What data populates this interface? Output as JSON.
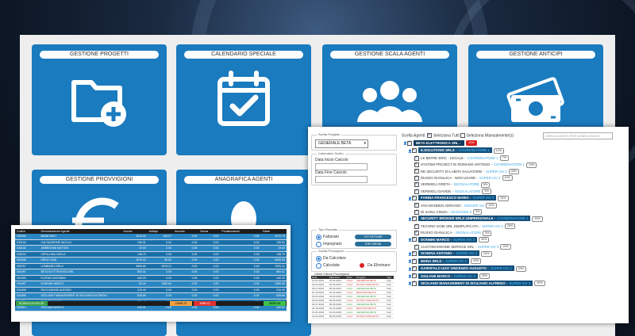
{
  "tiles": [
    {
      "label": "GESTIONE PROGETTI",
      "icon": "folder-plus-icon"
    },
    {
      "label": "CALENDARIO SPECIALE",
      "icon": "calendar-check-icon"
    },
    {
      "label": "GESTIONE SCALA AGENTI",
      "icon": "users-group-icon"
    },
    {
      "label": "GESTIONE ANTICIPI",
      "icon": "money-bills-icon"
    },
    {
      "label": "GESTIONE PROVVIGIONI",
      "icon": "euro-icon"
    },
    {
      "label": "ANAGRAFICA AGENTI",
      "icon": "person-icon"
    }
  ],
  "commission_table": {
    "headers": [
      "Codice",
      "Denominazione Agente",
      "Dovuto",
      "Anticipi",
      "Acconto",
      "Bonus",
      "Penalizzazioni",
      "Totale"
    ],
    "rows": [
      [
        "035090",
        "MINNI BRCI",
        "4310.00",
        "105.07",
        "0.00",
        "0.00",
        "0.00",
        "4072.75"
      ],
      [
        "033134",
        "CALTAGIRONE NICOLA",
        "130.01",
        "0.00",
        "0.00",
        "0.00",
        "0.00",
        "130.01"
      ],
      [
        "033130",
        "AMBROSINI MATTEO",
        "19.03",
        "0.00",
        "0.00",
        "0.00",
        "0.00",
        "19.03"
      ],
      [
        "035102",
        "CIPOLLINA CARLO",
        "138.70",
        "0.00",
        "0.00",
        "0.00",
        "0.00",
        "138.70"
      ],
      [
        "034938",
        "KREIZ CANI",
        "4075.10",
        "90.53",
        "0.00",
        "0.00",
        "0.00",
        "5083.93"
      ],
      [
        "033767",
        "LOMBARDI SRLS",
        "3606.80",
        "2875.31",
        "0.00",
        "0.00",
        "0.00",
        "6781.11"
      ],
      [
        "034497",
        "BETA ELETTRONICA SRL",
        "800.01",
        "0.00",
        "0.00",
        "0.00",
        "0.00",
        "800.01"
      ],
      [
        "034490",
        "ELEFAN GIOVANNI",
        "440.20",
        "0.00",
        "0.00",
        "0.00",
        "0.00",
        "440.20"
      ],
      [
        "034497",
        "DONNINI MARCO",
        "-32.44",
        "1382.84",
        "0.00",
        "0.00",
        "0.00",
        "1350.40"
      ],
      [
        "034498",
        "RUCCANONE ALESSIO",
        "210.40",
        "0.00",
        "0.00",
        "0.00",
        "0.00",
        "210.40"
      ],
      [
        "034496",
        "SICILIANO MANAGEMENT DI SICILIANO ALFREDO",
        "618.69",
        "0.00",
        "0.00",
        "0.00",
        "0.00",
        "628.68"
      ],
      [
        "034524",
        "CAVICCHI UGO",
        "650.40",
        "0.00",
        "0.00",
        "0.00",
        "0.00",
        "650.40"
      ],
      [
        "034510",
        "GIULIANI MARCO",
        "440.91",
        "0.00",
        "0.00",
        "0.00",
        "0.00",
        "440.91"
      ]
    ],
    "export_label": "SCARICA IN EXCEL",
    "totals": {
      "dovuto": "19455.73",
      "anticipi": "5985.13",
      "totale": "26090.55"
    }
  },
  "filters": {
    "project_legend": "Scelta Progetto",
    "project_value": "GENERALE BETA",
    "period_legend": "Calendario Scelto",
    "start_label": "Data Inizio Calcolo",
    "end_label": "Data Fine Calcolo",
    "type_legend": "Tipo Ricavato",
    "fatturato": "Fatturato",
    "impegnato": "Impegnato",
    "pill_fatt": "TOT FATTURE",
    "pill_imp": "FOR ORDINI",
    "calc_legend": "Scelta Provvigioni",
    "da_calcolare": "Da Calcolare",
    "calcolate": "Calcolate",
    "da_eliminare": "Da Eliminare",
    "minitable_legend": "Ultimi Calcoli Provvigioni"
  },
  "mini_table": {
    "headers": [
      "Data",
      "Data Fine",
      "Stato",
      "Progetto",
      "Tipo"
    ],
    "rows": [
      [
        "01-01-2021",
        "31-03-2021",
        "CALC",
        "GENERALE BETA",
        "Fatt",
        "red"
      ],
      [
        "01-04-2021",
        "30-06-2021",
        "CALC",
        "ROSSO PROGETTO",
        "Fatt",
        "red"
      ],
      [
        "01-07-2021",
        "30-09-2021",
        "CALC",
        "GENERALE BETA",
        "Fatt",
        "grn"
      ],
      [
        "01-10-2021",
        "31-12-2021",
        "CALC",
        "BETA PROGETTO",
        "Fatt",
        "red"
      ],
      [
        "01-01-2022",
        "31-03-2022",
        "CALC",
        "GENERALE BETA",
        "Fatt",
        "grn"
      ],
      [
        "01-04-2022",
        "30-06-2022",
        "CALC",
        "ROSSO PROGETTO",
        "Fatt",
        "red"
      ],
      [
        "01-07-2022",
        "30-09-2022",
        "CALC",
        "GENERALE BETA",
        "Fatt",
        "grn"
      ],
      [
        "01-10-2022",
        "31-12-2022",
        "CALC",
        "BETA PROGETTO",
        "Fatt",
        "red"
      ],
      [
        "01-01-2023",
        "31-03-2023",
        "CALC",
        "GENERALE BETA",
        "Fatt",
        "grn"
      ],
      [
        "01-04-2023",
        "30-06-2023",
        "CALC",
        "ROSSO PROGETTO",
        "Fatt",
        "red"
      ]
    ]
  },
  "agents_panel": {
    "header": "Scelta Agenti:",
    "select_all": "Seleziona Tutti",
    "select_manual": "Seleziona Manualmente(s)",
    "search_placeholder": "CERCA AGENTI PER NOME/CODICE",
    "rows": [
      {
        "text": "BETA ELETTRONICA SRL -",
        "role": "",
        "pct": "10%",
        "type": "bar-top",
        "pctRed": true
      },
      {
        "text": "E.SOLUTIONS SRLS -",
        "role": "COORDINATORE 1",
        "pct": "10%",
        "type": "bar"
      },
      {
        "text": "LE BEFRE ERIC - LEGALE -",
        "role": "COORDINATORE 1",
        "pct": "7%",
        "type": "sub"
      },
      {
        "text": "SYSTEM PROJECT DI ROMANO ANTONIO -",
        "role": "COORDINATORE 1",
        "pct": "10%",
        "type": "sub"
      },
      {
        "text": "RE SECURITY DI LABITA SALVATORE -",
        "role": "SUPER IAV 2",
        "pct": "20%",
        "type": "sub"
      },
      {
        "text": "RUSSO GIANLUCA - NON USARE -",
        "role": "SUPER IAV 2",
        "pct": "10%",
        "type": "sub"
      },
      {
        "text": "VERMIGLI GRETA -",
        "role": "SEGNALATORE",
        "pct": "5%",
        "type": "sub"
      },
      {
        "text": "VERMIGLI DAVIDE -",
        "role": "SEGNALATORE",
        "pct": "5%",
        "type": "sub"
      },
      {
        "text": "FARINA FRANCESCO MARIA -",
        "role": "SUPER IAV 2",
        "pct": "20%",
        "type": "bar"
      },
      {
        "text": "VAN WANDEN ADRIANO -",
        "role": "INDOOR IAV",
        "pct": "10%",
        "type": "sub"
      },
      {
        "text": "DI SARLI CINZIA -",
        "role": "MANAGER 3",
        "pct": "5%",
        "type": "sub"
      },
      {
        "text": "SECURITY BROKER SRLS UNIPERSONALE -",
        "role": "COORDINATORE 1",
        "pct": "20%",
        "type": "bar"
      },
      {
        "text": "TECHNO GOBI SRL SEMPLIFICATA -",
        "role": "SUPER IAV 2",
        "pct": "20%",
        "type": "sub"
      },
      {
        "text": "RUSSO GIANLUCA -",
        "role": "SEGNALATORE",
        "pct": "5%",
        "type": "sub"
      },
      {
        "text": "DONNINI MARCO -",
        "role": "SUPER IAV 2",
        "pct": "30%",
        "type": "bar"
      },
      {
        "text": "CUSTOM ENGINE SERVICE SRL -",
        "role": "SUPER IAV 2",
        "pct": "20%",
        "type": "sub"
      },
      {
        "text": "SCHENA ANTONIO -",
        "role": "SUPER IAV 2",
        "pct": "20%",
        "type": "bar"
      },
      {
        "text": "MONA SRLS -",
        "role": "SUPER IAV 2",
        "pct": "20%",
        "type": "bar"
      },
      {
        "text": "GAROFALO UGO VINCENZO AUGUSTO -",
        "role": "SUPER IAV 2",
        "pct": "20%",
        "type": "bar"
      },
      {
        "text": "GIULIANI MARCO -",
        "role": "SUPER IAV 2",
        "pct": "20%",
        "type": "bar"
      },
      {
        "text": "SICILIANO MANAGEMENT DI SICILIANO ALFREDO -",
        "role": "SUPER IAV 2",
        "pct": "20%",
        "type": "bar"
      }
    ]
  },
  "colors": {
    "tile_blue": "#1a7bbf",
    "bar_blue": "#164f7a",
    "role_cyan": "#3aa7e3",
    "excel_green": "#3aa04a",
    "alert_red": "#dd2222"
  }
}
